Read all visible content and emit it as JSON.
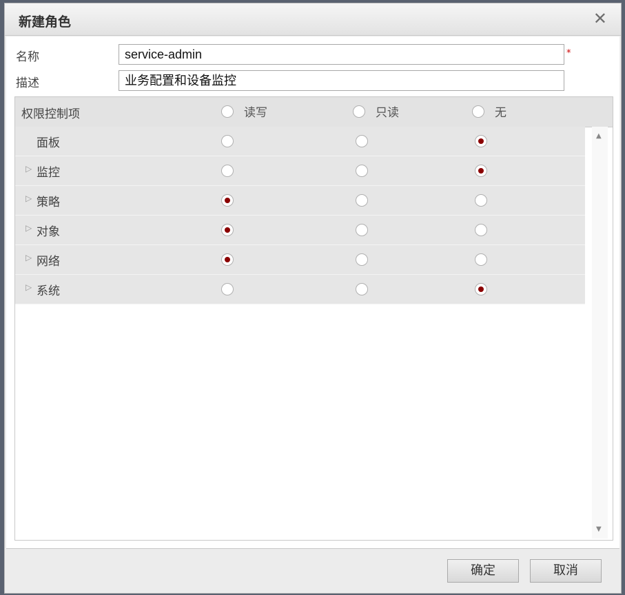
{
  "dialog": {
    "title": "新建角色",
    "close_glyph": "✕"
  },
  "form": {
    "name_label": "名称",
    "name_value": "service-admin",
    "required_mark": "*",
    "desc_label": "描述",
    "desc_value": "业务配置和设备监控"
  },
  "permissions": {
    "header_label": "权限控制项",
    "columns": [
      "读写",
      "只读",
      "无"
    ],
    "rows": [
      {
        "name": "面板",
        "expandable": false,
        "selected": "无"
      },
      {
        "name": "监控",
        "expandable": true,
        "selected": "无"
      },
      {
        "name": "策略",
        "expandable": true,
        "selected": "读写"
      },
      {
        "name": "对象",
        "expandable": true,
        "selected": "读写"
      },
      {
        "name": "网络",
        "expandable": true,
        "selected": "读写"
      },
      {
        "name": "系统",
        "expandable": true,
        "selected": "无"
      }
    ],
    "expand_icon": "▷",
    "scroll_up_icon": "▲",
    "scroll_down_icon": "▼"
  },
  "footer": {
    "ok_label": "确定",
    "cancel_label": "取消"
  },
  "colors": {
    "radio_selected": "#8b0000",
    "required": "#cc0000"
  }
}
